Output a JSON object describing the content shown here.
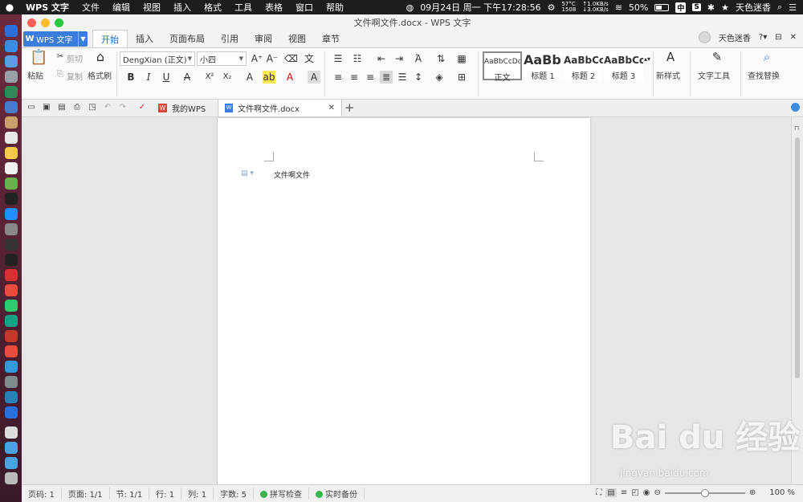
{
  "menubar": {
    "app_name": "WPS 文字",
    "menus": [
      "文件",
      "编辑",
      "视图",
      "插入",
      "格式",
      "工具",
      "表格",
      "窗口",
      "帮助"
    ],
    "datetime": "09月24日 周一 下午17:28:56",
    "temp": "57°C",
    "net_up": "↑1.0KB/s",
    "net_down": "↓3.0KB/s",
    "net_left": "1508",
    "battery": "50%",
    "input_method": "中",
    "user_name": "天色迷香"
  },
  "window": {
    "title": "文件啊文件.docx - WPS 文字"
  },
  "app_button": {
    "label": "WPS 文字"
  },
  "ribbon_tabs": [
    "开始",
    "插入",
    "页面布局",
    "引用",
    "审阅",
    "视图",
    "章节"
  ],
  "account": {
    "name": "天色迷香"
  },
  "ribbon": {
    "paste": "粘贴",
    "cut": "剪切",
    "copy": "复制",
    "format_painter": "格式刷",
    "font_name": "DengXian (正文)",
    "font_size": "小四",
    "styles": [
      {
        "sample": "AaBbCcDd",
        "name": "正文"
      },
      {
        "sample": "AaBb(",
        "name": "标题 1"
      },
      {
        "sample": "AaBbCc",
        "name": "标题 2"
      },
      {
        "sample": "AaBbCc",
        "name": "标题 3"
      }
    ],
    "new_style": "新样式",
    "text_tools": "文字工具",
    "find_replace": "查找替换"
  },
  "doc_tabs": [
    {
      "label": "我的WPS"
    },
    {
      "label": "文件啊文件.docx"
    }
  ],
  "document": {
    "body_text": "文件啊文件"
  },
  "statusbar": {
    "page_num": "页码: 1",
    "page_count": "页面: 1/1",
    "section": "节: 1/1",
    "row": "行: 1",
    "col": "列: 1",
    "word_count": "字数: 5",
    "spell_check": "拼写检查",
    "backup": "实时备份",
    "zoom_level": "100 %"
  },
  "watermark": {
    "brand": "Bai du 经验",
    "url": "jingyan.baidu.com"
  },
  "colors": {
    "accent": "#3b7ddd",
    "menubar_bg": "#1d1d1f",
    "dock_bg": "#6d2a3d"
  }
}
